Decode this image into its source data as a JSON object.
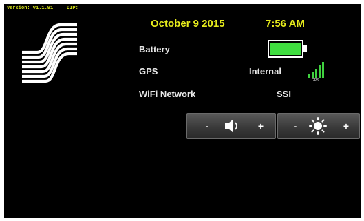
{
  "header": {
    "version": "Version: v1.1.91",
    "dip": "DIP:"
  },
  "status": {
    "date": "October 9 2015",
    "time": "7:56 AM"
  },
  "rows": {
    "battery_label": "Battery",
    "gps_label": "GPS",
    "gps_value": "Internal",
    "gps_icon_caption": "GPS",
    "wifi_label": "WiFi Network",
    "wifi_value": "SSI"
  },
  "battery": {
    "level": 1.0,
    "color": "#3fdc3f"
  },
  "controls": {
    "volume": {
      "minus": "-",
      "plus": "+",
      "icon": "speaker-icon"
    },
    "brightness": {
      "minus": "-",
      "plus": "+",
      "icon": "sun-icon"
    }
  },
  "colors": {
    "accent_yellow": "#e6eb1c",
    "text": "#e8e8e8",
    "background": "#000000",
    "signal_green": "#3fd13f"
  }
}
